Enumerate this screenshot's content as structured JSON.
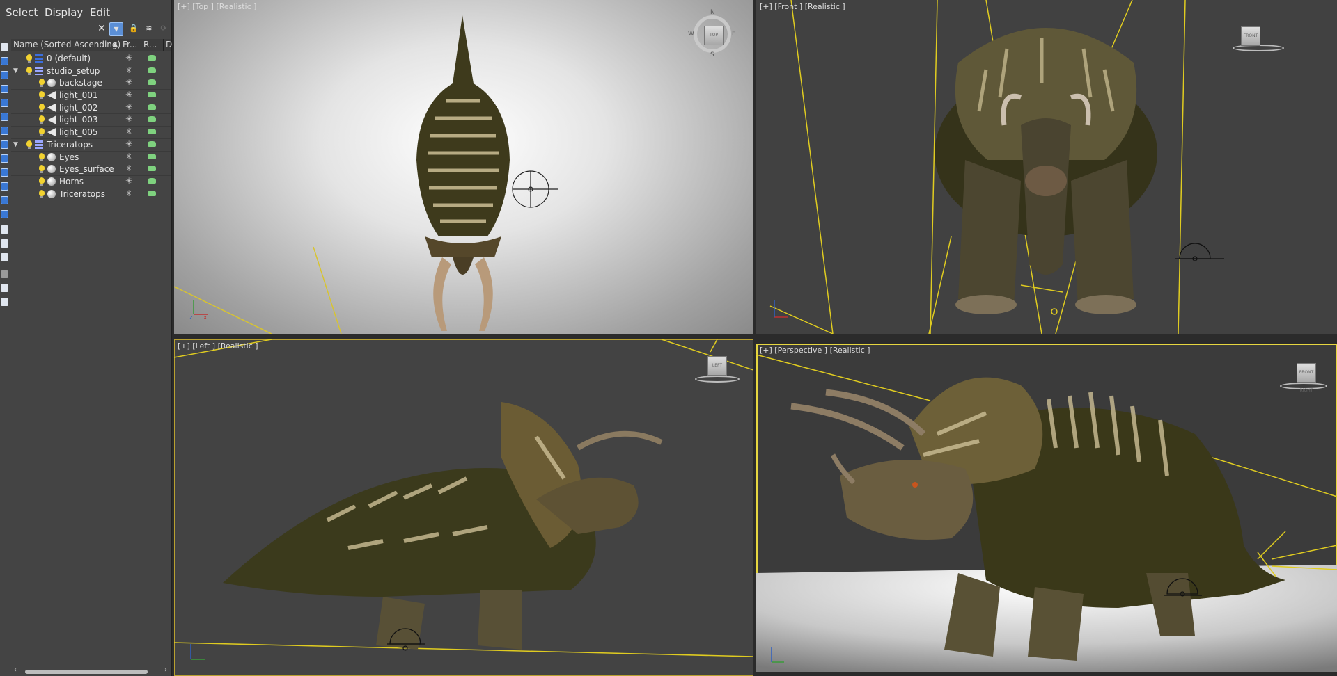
{
  "menu": {
    "select": "Select",
    "display": "Display",
    "edit": "Edit"
  },
  "explorer": {
    "columns": {
      "name": "Name (Sorted Ascending)",
      "frozen": "Fr...",
      "renderable": "R...",
      "extra": "D"
    },
    "rows": [
      {
        "label": "0 (default)",
        "type": "layerblue",
        "indent": 0,
        "expand": ""
      },
      {
        "label": "studio_setup",
        "type": "layer",
        "indent": 0,
        "expand": "▼"
      },
      {
        "label": "backstage",
        "type": "sphere",
        "indent": 1,
        "expand": ""
      },
      {
        "label": "light_001",
        "type": "light",
        "indent": 1,
        "expand": ""
      },
      {
        "label": "light_002",
        "type": "light",
        "indent": 1,
        "expand": ""
      },
      {
        "label": "light_003",
        "type": "light",
        "indent": 1,
        "expand": ""
      },
      {
        "label": "light_005",
        "type": "light",
        "indent": 1,
        "expand": ""
      },
      {
        "label": "Triceratops",
        "type": "layer",
        "indent": 0,
        "expand": "▼"
      },
      {
        "label": "Eyes",
        "type": "sphere",
        "indent": 1,
        "expand": ""
      },
      {
        "label": "Eyes_surface",
        "type": "sphere",
        "indent": 1,
        "expand": ""
      },
      {
        "label": "Horns",
        "type": "sphere",
        "indent": 1,
        "expand": ""
      },
      {
        "label": "Triceratops",
        "type": "sphere",
        "indent": 1,
        "expand": ""
      }
    ]
  },
  "viewports": {
    "top": {
      "label": "[+] [Top ] [Realistic ]",
      "cube": "TOP"
    },
    "front": {
      "label": "[+] [Front ] [Realistic ]",
      "cube": "FRONT"
    },
    "left": {
      "label": "[+] [Left ] [Realistic ]",
      "cube": "LEFT"
    },
    "perspective": {
      "label": "[+] [Perspective ] [Realistic ]",
      "cube": "FRONT RIGHT"
    }
  },
  "compass": {
    "n": "N",
    "s": "S",
    "e": "E",
    "w": "W"
  },
  "axes": {
    "x": "x",
    "y": "y",
    "z": "z"
  },
  "colors": {
    "selection_yellow": "#e6d640",
    "light_line": "#e0cc20",
    "toolbar_active": "#5b8fd6"
  }
}
